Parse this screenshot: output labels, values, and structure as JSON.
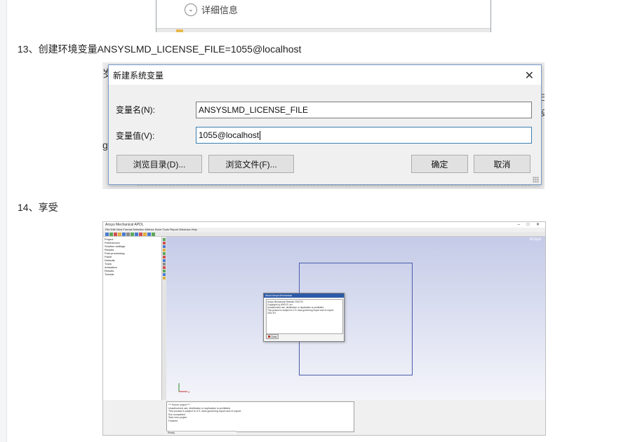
{
  "top_shot": {
    "details_label": "详细信息"
  },
  "steps": {
    "step13": "13、创建环境变量ANSYSLMD_LICENSE_FILE=1055@localhost",
    "step14": "14、享受"
  },
  "env_dialog": {
    "title": "新建系统变量",
    "close_glyph": "✕",
    "name_label": "变量名(N):",
    "name_value": "ANSYSLMD_LICENSE_FILE",
    "value_label": "变量值(V):",
    "value_value": "1055@localhost",
    "browse_dir_button": "浏览目录(D)...",
    "browse_file_button": "浏览文件(F)...",
    "ok_button": "确定",
    "cancel_button": "取消"
  },
  "ansys_app": {
    "window_title": "Ansys Mechanical APDL",
    "menu": "File  Edit  View  Format  Selection  Metrics  Solve  Tools  Report  Windows  Help",
    "brand": "Ansys",
    "tree": [
      "Project",
      "Preferences",
      "Solution settings",
      "Results",
      "Post processing",
      "Panel",
      "Defaults",
      "Track",
      "Animation",
      "Results",
      "Tutorial"
    ],
    "about_title": "About Ansys Mechanical",
    "about_lines": [
      "Ansys Mechanical Release 2022 R1",
      "Copyright (c) ANSYS, Inc.",
      "Unauthorized use, distribution or duplication is prohibited.",
      "This product is subject to U.S. laws governing export and re-export.",
      "2022 R1"
    ],
    "about_ok": "Close",
    "output_lines": [
      "*** Solver output ***",
      "Unauthorized use, distribution or duplication is prohibited.",
      "This product is subject to U.S. laws governing export and re-export.",
      "Run completed.",
      "Start new project",
      "Finished"
    ],
    "status": "Ready"
  },
  "colors": {
    "dialog_border": "#7a9cc9",
    "viewport_top": "#c5cbe8",
    "active_field": "#3c7fb1"
  }
}
